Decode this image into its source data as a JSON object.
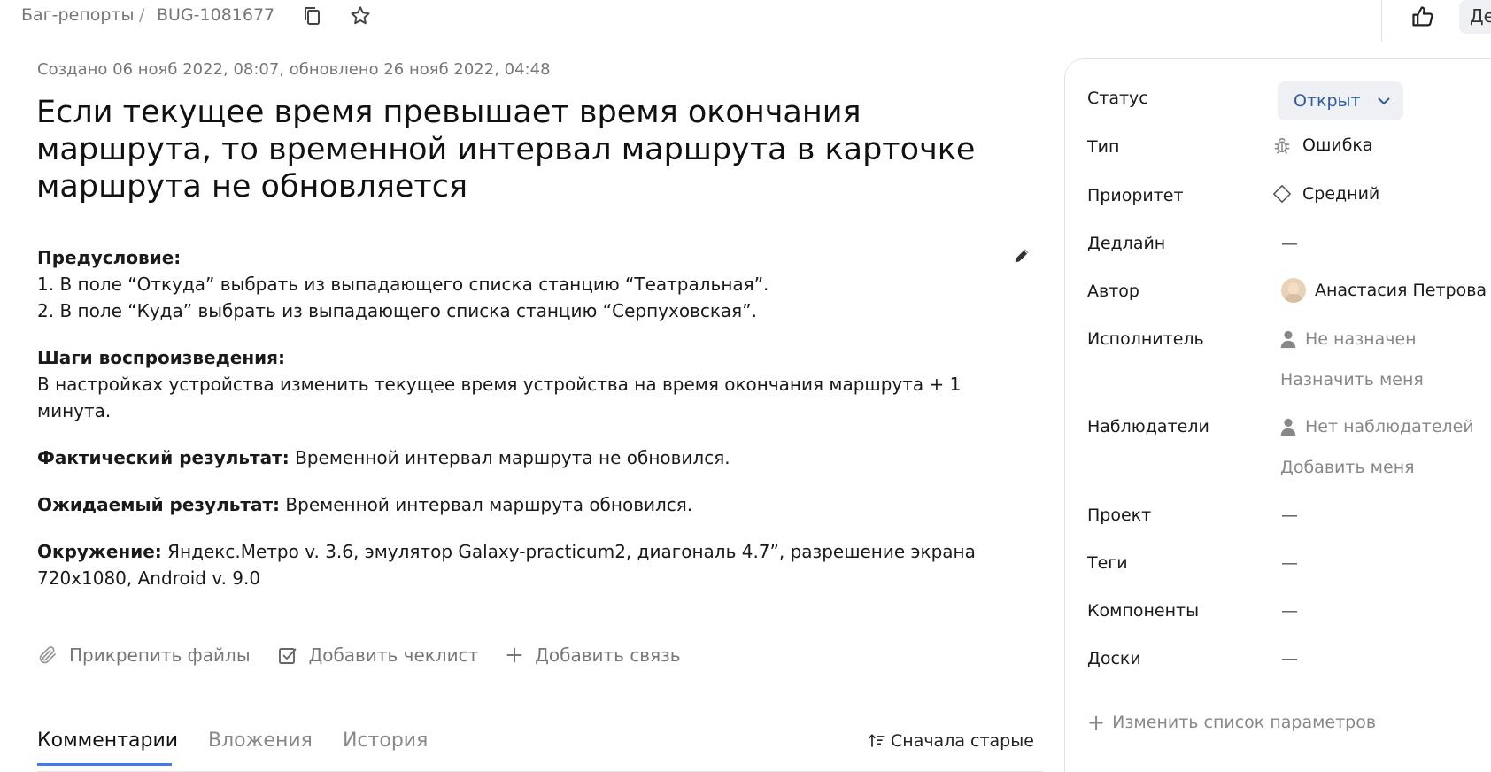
{
  "breadcrumb": {
    "section": "Баг-репорты",
    "separator": "/",
    "issue_key": "BUG-1081677"
  },
  "header_cut_button": "Де",
  "meta": "Создано 06 нояб 2022, 08:07, обновлено 26 нояб 2022, 04:48",
  "title": "Если текущее время превышает время окончания маршрута, то временной интервал маршрута в карточке маршрута не обновляется",
  "description": {
    "precondition_label": "Предусловие:",
    "precondition_lines": [
      "1. В поле “Откуда” выбрать из выпадающего списка станцию “Театральная”.",
      "2. В поле “Куда” выбрать из выпадающего списка станцию “Серпуховская”."
    ],
    "steps_label": "Шаги воспроизведения:",
    "steps_text": "В настройках устройства изменить текущее время устройства на время окончания маршрута + 1 минута.",
    "actual_label": "Фактический результат:",
    "actual_text": " Временной интервал маршрута не обновился.",
    "expected_label": "Ожидаемый результат:",
    "expected_text": " Временной интервал маршрута обновился.",
    "env_label": "Окружение:",
    "env_text": " Яндекс.Метро v. 3.6, эмулятор Galaxy-practicum2, диагональ 4.7”, разрешение экрана 720x1080, Android v. 9.0"
  },
  "actions": {
    "attach": "Прикрепить файлы",
    "checklist": "Добавить чеклист",
    "link": "Добавить связь"
  },
  "tabs": {
    "comments": "Комментарии",
    "attachments": "Вложения",
    "history": "История",
    "sort": "Сначала старые"
  },
  "sidebar": {
    "status_label": "Статус",
    "status_value": "Открыт",
    "type_label": "Тип",
    "type_value": "Ошибка",
    "priority_label": "Приоритет",
    "priority_value": "Средний",
    "deadline_label": "Дедлайн",
    "deadline_value": "—",
    "author_label": "Автор",
    "author_value": "Анастасия Петрова",
    "assignee_label": "Исполнитель",
    "assignee_value": "Не назначен",
    "assign_me": "Назначить меня",
    "watchers_label": "Наблюдатели",
    "watchers_value": "Нет наблюдателей",
    "add_me": "Добавить меня",
    "project_label": "Проект",
    "project_value": "—",
    "tags_label": "Теги",
    "tags_value": "—",
    "components_label": "Компоненты",
    "components_value": "—",
    "boards_label": "Доски",
    "boards_value": "—",
    "change_params": "Изменить список параметров"
  },
  "colors": {
    "accent": "#3f7cf0",
    "status_text": "#2f5b9a",
    "muted": "#888888"
  }
}
